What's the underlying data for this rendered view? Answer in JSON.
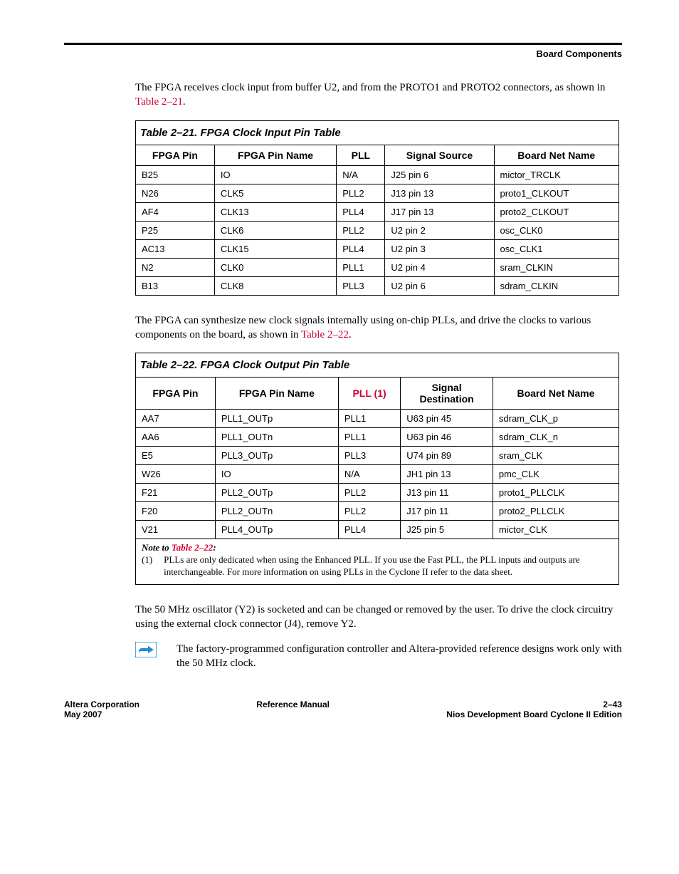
{
  "header": {
    "section": "Board Components"
  },
  "para1": {
    "text_a": "The FPGA receives clock input from buffer U2, and from the PROTO1 and PROTO2 connectors, as shown in ",
    "link": "Table 2–21",
    "text_b": "."
  },
  "table21": {
    "caption": "Table 2–21. FPGA Clock Input Pin Table",
    "headers": [
      "FPGA Pin",
      "FPGA Pin Name",
      "PLL",
      "Signal Source",
      "Board Net Name"
    ],
    "rows": [
      [
        "B25",
        "IO",
        "N/A",
        "J25 pin 6",
        "mictor_TRCLK"
      ],
      [
        "N26",
        "CLK5",
        "PLL2",
        "J13 pin 13",
        "proto1_CLKOUT"
      ],
      [
        "AF4",
        "CLK13",
        "PLL4",
        "J17 pin 13",
        "proto2_CLKOUT"
      ],
      [
        "P25",
        "CLK6",
        "PLL2",
        "U2 pin 2",
        "osc_CLK0"
      ],
      [
        "AC13",
        "CLK15",
        "PLL4",
        "U2 pin 3",
        "osc_CLK1"
      ],
      [
        "N2",
        "CLK0",
        "PLL1",
        "U2 pin 4",
        "sram_CLKIN"
      ],
      [
        "B13",
        "CLK8",
        "PLL3",
        "U2 pin 6",
        "sdram_CLKIN"
      ]
    ]
  },
  "para2": {
    "text_a": "The FPGA can synthesize new clock signals internally using on-chip PLLs, and drive the clocks to various components on the board, as shown in ",
    "link": "Table 2–22",
    "text_b": "."
  },
  "table22": {
    "caption": "Table 2–22. FPGA Clock Output Pin Table",
    "headers": {
      "c1": "FPGA Pin",
      "c2": "FPGA Pin Name",
      "c3a": "PLL",
      "c3b": " (1)",
      "c4a": "Signal",
      "c4b": "Destination",
      "c5": "Board Net Name"
    },
    "rows": [
      [
        "AA7",
        "PLL1_OUTp",
        "PLL1",
        "U63 pin 45",
        "sdram_CLK_p"
      ],
      [
        "AA6",
        "PLL1_OUTn",
        "PLL1",
        "U63 pin 46",
        "sdram_CLK_n"
      ],
      [
        "E5",
        "PLL3_OUTp",
        "PLL3",
        "U74 pin 89",
        "sram_CLK"
      ],
      [
        "W26",
        "IO",
        "N/A",
        "JH1 pin 13",
        "pmc_CLK"
      ],
      [
        "F21",
        "PLL2_OUTp",
        "PLL2",
        "J13 pin 11",
        "proto1_PLLCLK"
      ],
      [
        "F20",
        "PLL2_OUTn",
        "PLL2",
        "J17 pin 11",
        "proto2_PLLCLK"
      ],
      [
        "V21",
        "PLL4_OUTp",
        "PLL4",
        "J25 pin 5",
        "mictor_CLK"
      ]
    ]
  },
  "note": {
    "title_a": "Note to ",
    "title_link": "Table 2–22",
    "title_b": ":",
    "num": "(1)",
    "body": "PLLs are only dedicated when using the Enhanced PLL. If you use the Fast PLL, the PLL inputs and outputs are interchangeable. For more information on using PLLs in the Cyclone II refer to the data sheet."
  },
  "para3": "The 50 MHz oscillator (Y2) is socketed and can be changed or removed by the user. To drive the clock circuitry using the external clock connector (J4), remove Y2.",
  "pointer": "The factory-programmed configuration controller and Altera-provided reference designs work only with the 50 MHz clock.",
  "footer": {
    "left1": "Altera Corporation",
    "left2": "May 2007",
    "center": "Reference Manual",
    "right1": "2–43",
    "right2": "Nios Development Board Cyclone II Edition"
  },
  "chart_data": [
    {
      "type": "table",
      "title": "Table 2–21. FPGA Clock Input Pin Table",
      "columns": [
        "FPGA Pin",
        "FPGA Pin Name",
        "PLL",
        "Signal Source",
        "Board Net Name"
      ],
      "rows": [
        [
          "B25",
          "IO",
          "N/A",
          "J25 pin 6",
          "mictor_TRCLK"
        ],
        [
          "N26",
          "CLK5",
          "PLL2",
          "J13 pin 13",
          "proto1_CLKOUT"
        ],
        [
          "AF4",
          "CLK13",
          "PLL4",
          "J17 pin 13",
          "proto2_CLKOUT"
        ],
        [
          "P25",
          "CLK6",
          "PLL2",
          "U2 pin 2",
          "osc_CLK0"
        ],
        [
          "AC13",
          "CLK15",
          "PLL4",
          "U2 pin 3",
          "osc_CLK1"
        ],
        [
          "N2",
          "CLK0",
          "PLL1",
          "U2 pin 4",
          "sram_CLKIN"
        ],
        [
          "B13",
          "CLK8",
          "PLL3",
          "U2 pin 6",
          "sdram_CLKIN"
        ]
      ]
    },
    {
      "type": "table",
      "title": "Table 2–22. FPGA Clock Output Pin Table",
      "columns": [
        "FPGA Pin",
        "FPGA Pin Name",
        "PLL",
        "Signal Destination",
        "Board Net Name"
      ],
      "rows": [
        [
          "AA7",
          "PLL1_OUTp",
          "PLL1",
          "U63 pin 45",
          "sdram_CLK_p"
        ],
        [
          "AA6",
          "PLL1_OUTn",
          "PLL1",
          "U63 pin 46",
          "sdram_CLK_n"
        ],
        [
          "E5",
          "PLL3_OUTp",
          "PLL3",
          "U74 pin 89",
          "sram_CLK"
        ],
        [
          "W26",
          "IO",
          "N/A",
          "JH1 pin 13",
          "pmc_CLK"
        ],
        [
          "F21",
          "PLL2_OUTp",
          "PLL2",
          "J13 pin 11",
          "proto1_PLLCLK"
        ],
        [
          "F20",
          "PLL2_OUTn",
          "PLL2",
          "J17 pin 11",
          "proto2_PLLCLK"
        ],
        [
          "V21",
          "PLL4_OUTp",
          "PLL4",
          "J25 pin 5",
          "mictor_CLK"
        ]
      ]
    }
  ]
}
